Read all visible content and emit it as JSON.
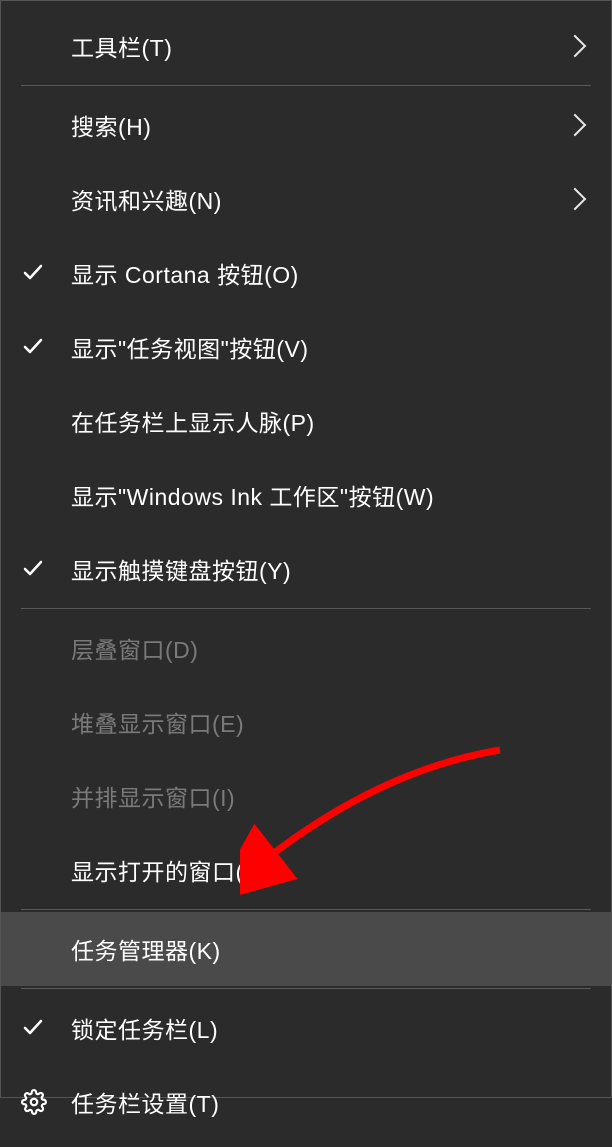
{
  "menu": {
    "items": [
      {
        "label": "工具栏(T)",
        "submenu": true,
        "checked": false,
        "disabled": false,
        "type": "item"
      },
      {
        "type": "separator"
      },
      {
        "label": "搜索(H)",
        "submenu": true,
        "checked": false,
        "disabled": false,
        "type": "item"
      },
      {
        "label": "资讯和兴趣(N)",
        "submenu": true,
        "checked": false,
        "disabled": false,
        "type": "item"
      },
      {
        "label": "显示 Cortana 按钮(O)",
        "submenu": false,
        "checked": true,
        "disabled": false,
        "type": "item"
      },
      {
        "label": "显示\"任务视图\"按钮(V)",
        "submenu": false,
        "checked": true,
        "disabled": false,
        "type": "item"
      },
      {
        "label": "在任务栏上显示人脉(P)",
        "submenu": false,
        "checked": false,
        "disabled": false,
        "type": "item"
      },
      {
        "label": "显示\"Windows Ink 工作区\"按钮(W)",
        "submenu": false,
        "checked": false,
        "disabled": false,
        "type": "item"
      },
      {
        "label": "显示触摸键盘按钮(Y)",
        "submenu": false,
        "checked": true,
        "disabled": false,
        "type": "item"
      },
      {
        "type": "separator"
      },
      {
        "label": "层叠窗口(D)",
        "submenu": false,
        "checked": false,
        "disabled": true,
        "type": "item"
      },
      {
        "label": "堆叠显示窗口(E)",
        "submenu": false,
        "checked": false,
        "disabled": true,
        "type": "item"
      },
      {
        "label": "并排显示窗口(I)",
        "submenu": false,
        "checked": false,
        "disabled": true,
        "type": "item"
      },
      {
        "label": "显示打开的窗口(S)",
        "submenu": false,
        "checked": false,
        "disabled": false,
        "type": "item"
      },
      {
        "type": "separator"
      },
      {
        "label": "任务管理器(K)",
        "submenu": false,
        "checked": false,
        "disabled": false,
        "type": "item",
        "highlighted": true
      },
      {
        "type": "separator"
      },
      {
        "label": "锁定任务栏(L)",
        "submenu": false,
        "checked": true,
        "disabled": false,
        "type": "item"
      },
      {
        "label": "任务栏设置(T)",
        "submenu": false,
        "checked": false,
        "disabled": false,
        "type": "item",
        "icon": "gear"
      }
    ]
  },
  "annotation": {
    "color": "#ff0000"
  }
}
